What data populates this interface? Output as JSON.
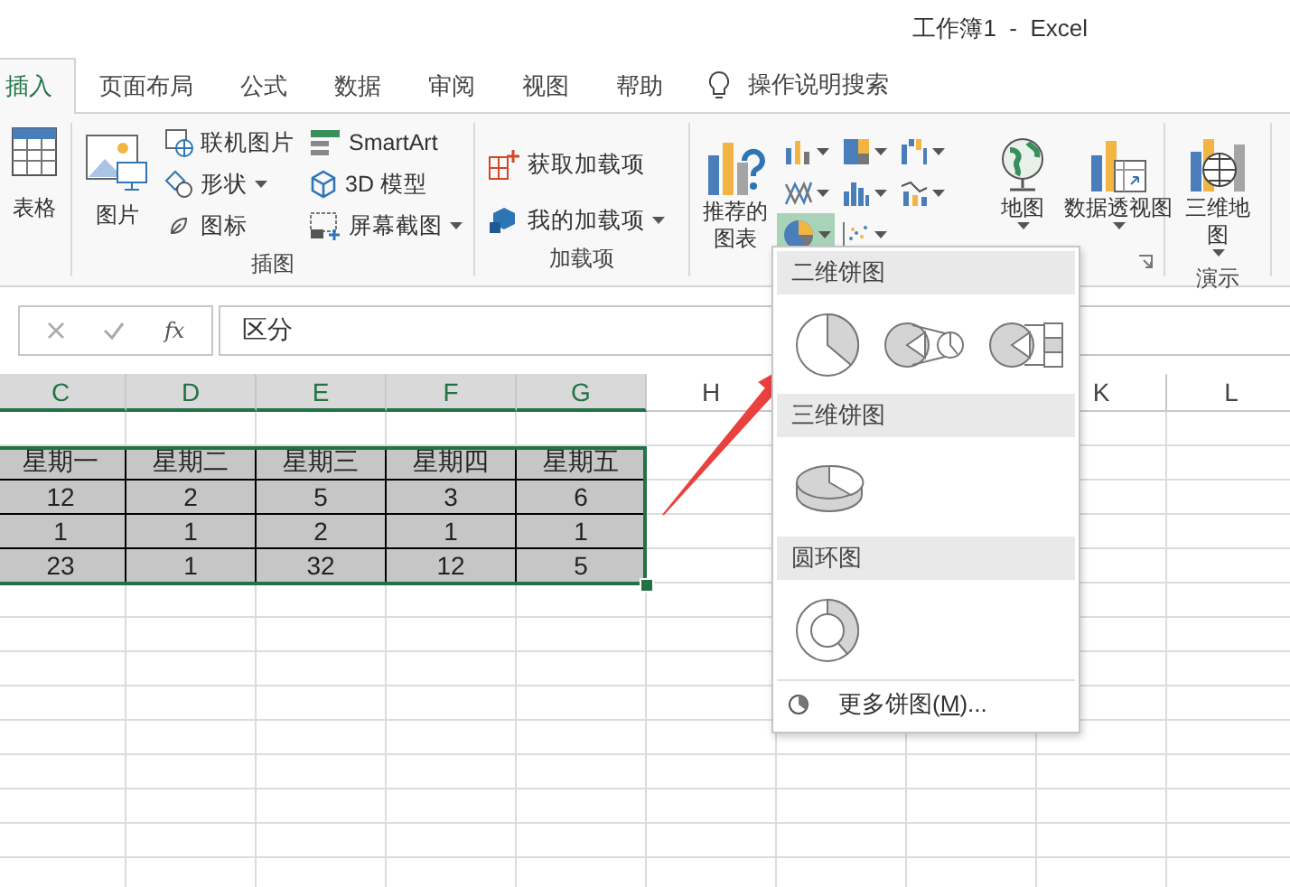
{
  "window": {
    "title": "工作簿1  -  Excel"
  },
  "tabs": [
    {
      "label": "插入",
      "selected": true
    },
    {
      "label": "页面布局",
      "selected": false
    },
    {
      "label": "公式",
      "selected": false
    },
    {
      "label": "数据",
      "selected": false
    },
    {
      "label": "审阅",
      "selected": false
    },
    {
      "label": "视图",
      "selected": false
    },
    {
      "label": "帮助",
      "selected": false
    }
  ],
  "tell_me": {
    "placeholder": "操作说明搜索"
  },
  "ribbon": {
    "tables": {
      "button": {
        "label": "表格"
      }
    },
    "illustrations": {
      "label": "插图",
      "picture": {
        "label": "图片"
      },
      "small_items": [
        {
          "label": "联机图片",
          "dropdown": false
        },
        {
          "label": "形状",
          "dropdown": true
        },
        {
          "label": "图标",
          "dropdown": false
        },
        {
          "label": "SmartArt",
          "dropdown": false
        },
        {
          "label": "3D 模型",
          "dropdown": false
        },
        {
          "label": "屏幕截图",
          "dropdown": true
        }
      ]
    },
    "addins": {
      "label": "加载项",
      "items": [
        {
          "label": "获取加载项",
          "dropdown": false
        },
        {
          "label": "我的加载项",
          "dropdown": true
        }
      ]
    },
    "charts": {
      "recommended": {
        "label": "推荐的图表"
      },
      "chart_buttons": [
        {
          "expanded": false
        },
        {
          "expanded": false
        },
        {
          "expanded": false
        },
        {
          "expanded": false
        },
        {
          "expanded": false
        },
        {
          "expanded": false
        },
        {
          "expanded": true
        },
        {
          "expanded": false
        }
      ],
      "maps": {
        "label": "地图"
      },
      "pivot_chart": {
        "label": "数据透视图"
      }
    },
    "tours": {
      "label": "演示",
      "button": {
        "label": "三维地图"
      }
    }
  },
  "formula_bar": {
    "function_label": "fx",
    "value": "区分"
  },
  "sheet": {
    "column_headers": [
      {
        "label": "C",
        "selected": true
      },
      {
        "label": "D",
        "selected": true
      },
      {
        "label": "E",
        "selected": true
      },
      {
        "label": "F",
        "selected": true
      },
      {
        "label": "G",
        "selected": true
      },
      {
        "label": "H",
        "selected": false
      },
      {
        "label": "K",
        "selected": false
      },
      {
        "label": "L",
        "selected": false
      }
    ],
    "table": [
      [
        "星期一",
        "星期二",
        "星期三",
        "星期四",
        "星期五"
      ],
      [
        "12",
        "2",
        "5",
        "3",
        "6"
      ],
      [
        "1",
        "1",
        "2",
        "1",
        "1"
      ],
      [
        "23",
        "1",
        "32",
        "12",
        "5"
      ]
    ]
  },
  "pie_menu": {
    "sections": [
      {
        "title": "二维饼图",
        "charts": [
          {
            "kind": "pie"
          },
          {
            "kind": "pie-of-pie"
          },
          {
            "kind": "bar-of-pie"
          }
        ]
      },
      {
        "title": "三维饼图",
        "charts": [
          {
            "kind": "pie-3d"
          }
        ]
      },
      {
        "title": "圆环图",
        "charts": [
          {
            "kind": "doughnut"
          }
        ]
      }
    ],
    "more": {
      "label_before": "更多饼图(",
      "access_key": "M",
      "label_after": ")..."
    }
  }
}
